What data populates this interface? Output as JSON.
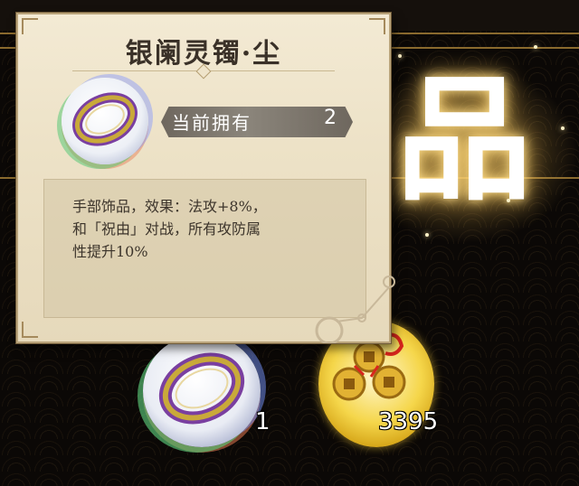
{
  "tooltip": {
    "title": "银阑灵镯·尘",
    "owned_label": "当前拥有",
    "owned_count": "2",
    "description": "手部饰品，效果：法攻+8%，\n和「祝由」对战，所有攻防属\n性提升10%"
  },
  "background": {
    "big_char": "品",
    "accent_color": "#8a6a2e"
  },
  "rewards": [
    {
      "icon": "silver-ring-icon",
      "count": "1"
    },
    {
      "icon": "copper-coins-icon",
      "count": "3395"
    }
  ],
  "colors": {
    "parchment": "#ede2c7",
    "plate": "#7a746b",
    "coin_gold": "#f5d64a"
  }
}
